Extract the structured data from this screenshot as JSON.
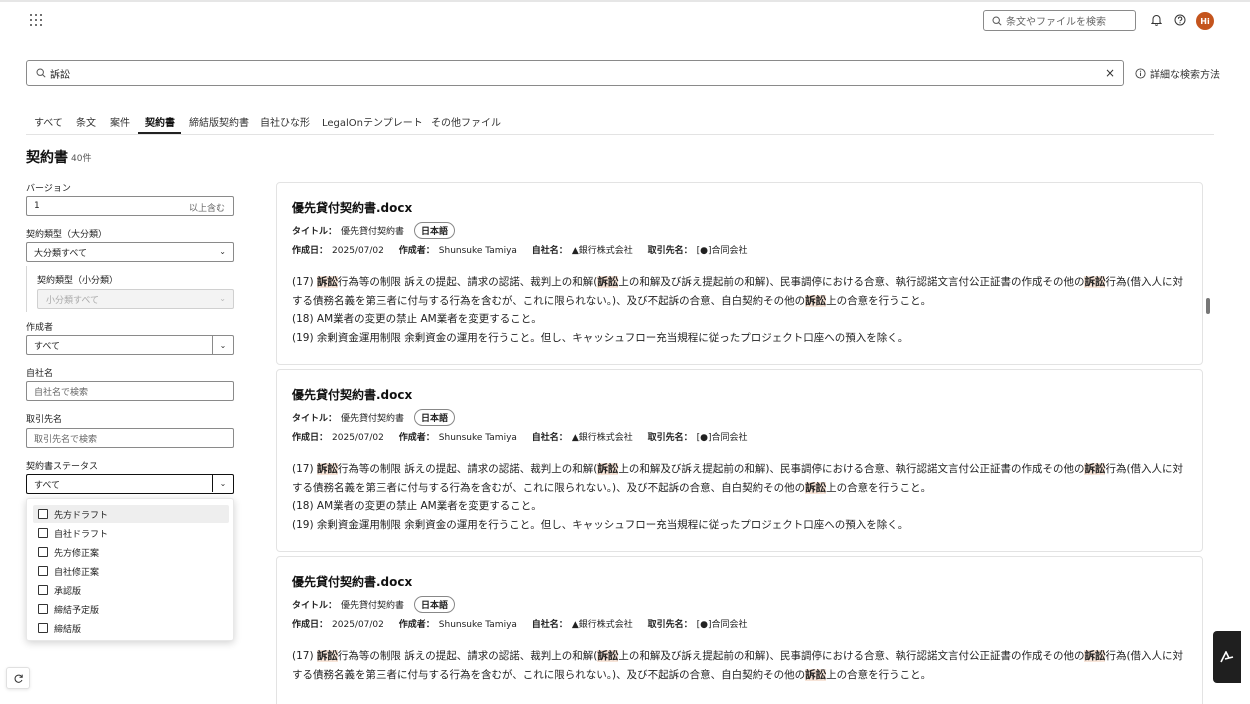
{
  "header": {
    "search_placeholder": "条文やファイルを検索",
    "avatar_initials": "Hi"
  },
  "search": {
    "query": "訴訟",
    "clear_label": "×",
    "advanced_label": "詳細な検索方法"
  },
  "tabs": [
    {
      "label": "すべて"
    },
    {
      "label": "条文"
    },
    {
      "label": "案件"
    },
    {
      "label": "契約書"
    },
    {
      "label": "締結版契約書"
    },
    {
      "label": "自社ひな形"
    },
    {
      "label": "LegalOnテンプレート"
    },
    {
      "label": "その他ファイル"
    }
  ],
  "active_tab": "契約書",
  "heading": {
    "title": "契約書",
    "count": "40件"
  },
  "filters": {
    "version_label": "バージョン",
    "version_value": "1",
    "version_suffix": "以上含む",
    "type_major_label": "契約類型（大分類）",
    "type_major_value": "大分類すべて",
    "type_minor_label": "契約類型（小分類）",
    "type_minor_value": "小分類すべて",
    "creator_label": "作成者",
    "creator_value": "すべて",
    "company_label": "自社名",
    "company_placeholder": "自社名で検索",
    "partner_label": "取引先名",
    "partner_placeholder": "取引先名で検索",
    "status_label": "契約書ステータス",
    "status_value": "すべて",
    "status_options": [
      {
        "label": "先方ドラフト"
      },
      {
        "label": "自社ドラフト"
      },
      {
        "label": "先方修正案"
      },
      {
        "label": "自社修正案"
      },
      {
        "label": "承認版"
      },
      {
        "label": "締結予定版"
      },
      {
        "label": "締結版"
      }
    ]
  },
  "result_labels": {
    "title": "タイトル：",
    "created": "作成日：",
    "author": "作成者：",
    "company": "自社名：",
    "partner": "取引先名："
  },
  "results": [
    {
      "filename": "優先貸付契約書.docx",
      "title": "優先貸付契約書",
      "language": "日本語",
      "created": "2025/07/02",
      "author": "Shunsuke Tamiya",
      "company": "▲銀行株式会社",
      "partner": "[●]合同会社",
      "p1": {
        "a": "(17) ",
        "b": "訴訟",
        "c": "行為等の制限 訴えの提起、請求の認諾、裁判上の和解(",
        "d": "訴訟",
        "e": "上の和解及び訴え提起前の和解)、民事調停における合意、執行認諾文言付公正証書の作成その他の",
        "f": "訴訟",
        "g": "行為(借入人に対する債務名義を第三者に付与する行為を含むが、これに限られない。)、及び不起訴の合意、自白契約その他の",
        "h": "訴訟",
        "i": "上の合意を行うこと。"
      },
      "p2": "(18) AM業者の変更の禁止 AM業者を変更すること。",
      "p3": "(19) 余剰資金運用制限 余剰資金の運用を行うこと。但し、キャッシュフロー充当規程に従ったプロジェクト口座への預入を除く。"
    },
    {
      "filename": "優先貸付契約書.docx",
      "title": "優先貸付契約書",
      "language": "日本語",
      "created": "2025/07/02",
      "author": "Shunsuke Tamiya",
      "company": "▲銀行株式会社",
      "partner": "[●]合同会社",
      "p1": {
        "a": "(17) ",
        "b": "訴訟",
        "c": "行為等の制限 訴えの提起、請求の認諾、裁判上の和解(",
        "d": "訴訟",
        "e": "上の和解及び訴え提起前の和解)、民事調停における合意、執行認諾文言付公正証書の作成その他の",
        "f": "訴訟",
        "g": "行為(借入人に対する債務名義を第三者に付与する行為を含むが、これに限られない。)、及び不起訴の合意、自白契約その他の",
        "h": "訴訟",
        "i": "上の合意を行うこと。"
      },
      "p2": "(18) AM業者の変更の禁止 AM業者を変更すること。",
      "p3": "(19) 余剰資金運用制限 余剰資金の運用を行うこと。但し、キャッシュフロー充当規程に従ったプロジェクト口座への預入を除く。"
    },
    {
      "filename": "優先貸付契約書.docx",
      "title": "優先貸付契約書",
      "language": "日本語",
      "created": "2025/07/02",
      "author": "Shunsuke Tamiya",
      "company": "▲銀行株式会社",
      "partner": "[●]合同会社",
      "p1": {
        "a": "(17) ",
        "b": "訴訟",
        "c": "行為等の制限 訴えの提起、請求の認諾、裁判上の和解(",
        "d": "訴訟",
        "e": "上の和解及び訴え提起前の和解)、民事調停における合意、執行認諾文言付公正証書の作成その他の",
        "f": "訴訟",
        "g": "行為(借入人に対する債務名義を第三者に付与する行為を含むが、これに限られない。)、及び不起訴の合意、自白契約その他の",
        "h": "訴訟",
        "i": "上の合意を行うこと。"
      }
    }
  ]
}
